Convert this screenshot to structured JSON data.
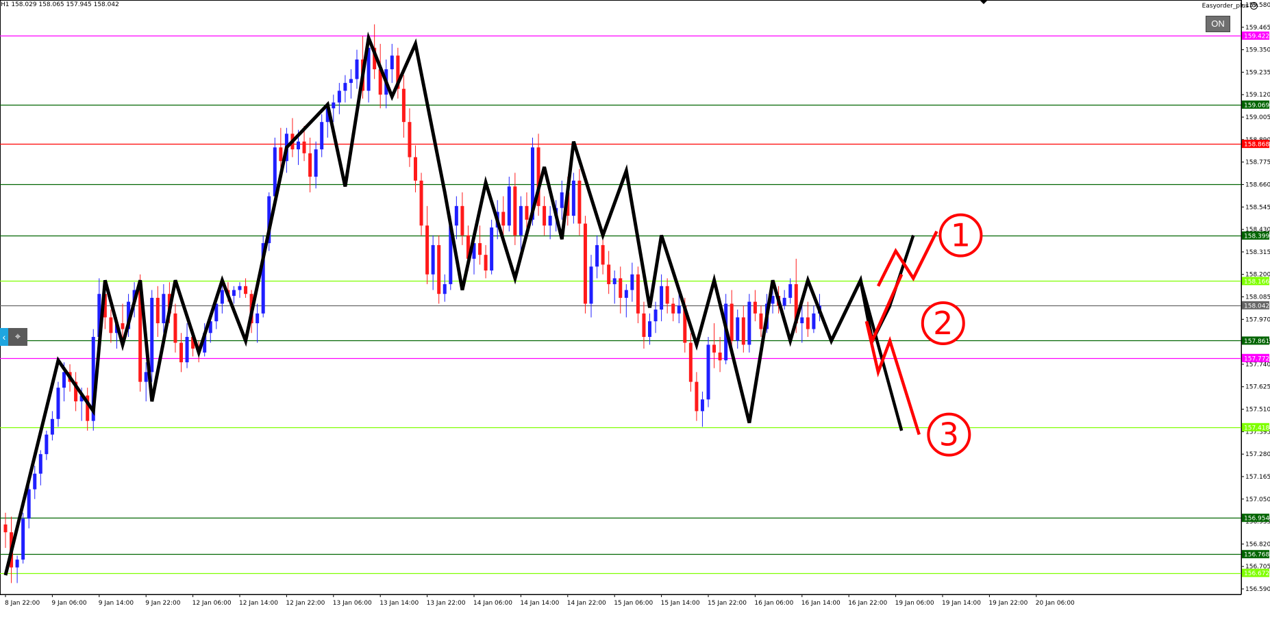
{
  "header": {
    "ohlc_text": "H1  158.029 158.065 157.945 158.042",
    "indicator_name": "Easyorder_plus",
    "indicator_icon": "smiley-icon",
    "on_button": "ON"
  },
  "tools": {
    "left_tool_icon": "arrow-left-icon",
    "cursor_tool_icon": "cursor-icon"
  },
  "chart_data": {
    "type": "candlestick",
    "symbol_timeframe": "H1",
    "ylim": [
      156.59,
      159.58
    ],
    "y_ticks": [
      "159.580",
      "159.465",
      "159.350",
      "159.235",
      "159.120",
      "159.005",
      "158.890",
      "158.775",
      "158.660",
      "158.545",
      "158.430",
      "158.315",
      "158.200",
      "158.085",
      "157.970",
      "157.855",
      "157.740",
      "157.625",
      "157.510",
      "157.395",
      "157.280",
      "157.165",
      "157.050",
      "156.935",
      "156.820",
      "156.705",
      "156.590"
    ],
    "x_ticks": [
      {
        "label": "8 Jan 22:00",
        "i": 0
      },
      {
        "label": "9 Jan 06:00",
        "i": 8
      },
      {
        "label": "9 Jan 14:00",
        "i": 16
      },
      {
        "label": "9 Jan 22:00",
        "i": 24
      },
      {
        "label": "12 Jan 06:00",
        "i": 32
      },
      {
        "label": "12 Jan 14:00",
        "i": 40
      },
      {
        "label": "12 Jan 22:00",
        "i": 48
      },
      {
        "label": "13 Jan 06:00",
        "i": 56
      },
      {
        "label": "13 Jan 14:00",
        "i": 64
      },
      {
        "label": "13 Jan 22:00",
        "i": 72
      },
      {
        "label": "14 Jan 06:00",
        "i": 80
      },
      {
        "label": "14 Jan 14:00",
        "i": 88
      },
      {
        "label": "14 Jan 22:00",
        "i": 96
      },
      {
        "label": "15 Jan 06:00",
        "i": 104
      },
      {
        "label": "15 Jan 14:00",
        "i": 112
      },
      {
        "label": "15 Jan 22:00",
        "i": 120
      },
      {
        "label": "16 Jan 06:00",
        "i": 128
      },
      {
        "label": "16 Jan 14:00",
        "i": 136
      },
      {
        "label": "16 Jan 22:00",
        "i": 144
      },
      {
        "label": "19 Jan 06:00",
        "i": 152
      },
      {
        "label": "19 Jan 14:00",
        "i": 160
      },
      {
        "label": "19 Jan 22:00",
        "i": 168
      },
      {
        "label": "20 Jan 06:00",
        "i": 176
      }
    ],
    "candle_colors": {
      "up": "#1f1fff",
      "down": "#ff1a1a"
    },
    "candles": [
      [
        156.92,
        156.98,
        156.8,
        156.88
      ],
      [
        156.88,
        156.96,
        156.62,
        156.7
      ],
      [
        156.7,
        156.76,
        156.62,
        156.74
      ],
      [
        156.74,
        156.98,
        156.72,
        156.95
      ],
      [
        156.95,
        157.15,
        156.9,
        157.1
      ],
      [
        157.1,
        157.22,
        157.05,
        157.18
      ],
      [
        157.18,
        157.3,
        157.12,
        157.28
      ],
      [
        157.28,
        157.4,
        157.25,
        157.38
      ],
      [
        157.38,
        157.5,
        157.35,
        157.46
      ],
      [
        157.46,
        157.65,
        157.42,
        157.62
      ],
      [
        157.62,
        157.75,
        157.55,
        157.7
      ],
      [
        157.7,
        157.74,
        157.6,
        157.65
      ],
      [
        157.65,
        157.7,
        157.5,
        157.55
      ],
      [
        157.55,
        157.62,
        157.45,
        157.58
      ],
      [
        157.58,
        157.62,
        157.4,
        157.45
      ],
      [
        157.45,
        157.92,
        157.4,
        157.88
      ],
      [
        157.88,
        158.18,
        157.8,
        158.1
      ],
      [
        158.1,
        158.15,
        157.92,
        157.98
      ],
      [
        157.98,
        158.02,
        157.85,
        157.9
      ],
      [
        157.9,
        157.98,
        157.82,
        157.95
      ],
      [
        157.95,
        158.05,
        157.86,
        157.92
      ],
      [
        157.92,
        158.1,
        157.88,
        158.06
      ],
      [
        158.06,
        158.16,
        157.98,
        158.12
      ],
      [
        158.12,
        158.2,
        157.6,
        157.65
      ],
      [
        157.65,
        157.75,
        157.55,
        157.7
      ],
      [
        157.7,
        158.12,
        157.65,
        158.08
      ],
      [
        158.08,
        158.14,
        157.88,
        157.95
      ],
      [
        157.95,
        158.15,
        157.9,
        158.1
      ],
      [
        158.1,
        158.16,
        157.95,
        158.0
      ],
      [
        158.0,
        158.05,
        157.8,
        157.85
      ],
      [
        157.85,
        157.9,
        157.7,
        157.75
      ],
      [
        157.75,
        157.95,
        157.72,
        157.88
      ],
      [
        157.88,
        157.92,
        157.78,
        157.82
      ],
      [
        157.82,
        157.86,
        157.75,
        157.8
      ],
      [
        157.8,
        157.95,
        157.78,
        157.9
      ],
      [
        157.9,
        158.0,
        157.85,
        157.96
      ],
      [
        157.96,
        158.1,
        157.92,
        158.05
      ],
      [
        158.05,
        158.15,
        158.0,
        158.12
      ],
      [
        158.12,
        158.16,
        158.06,
        158.09
      ],
      [
        158.09,
        158.14,
        158.05,
        158.12
      ],
      [
        158.12,
        158.16,
        158.08,
        158.14
      ],
      [
        158.14,
        158.18,
        158.08,
        158.1
      ],
      [
        158.1,
        158.12,
        157.9,
        157.95
      ],
      [
        157.95,
        158.05,
        157.85,
        158.0
      ],
      [
        158.0,
        158.4,
        157.98,
        158.36
      ],
      [
        158.36,
        158.62,
        158.32,
        158.6
      ],
      [
        158.6,
        158.9,
        158.55,
        158.85
      ],
      [
        158.85,
        158.95,
        158.7,
        158.78
      ],
      [
        158.78,
        158.95,
        158.72,
        158.92
      ],
      [
        158.92,
        159.0,
        158.8,
        158.84
      ],
      [
        158.84,
        158.94,
        158.76,
        158.88
      ],
      [
        158.88,
        158.96,
        158.78,
        158.82
      ],
      [
        158.82,
        158.9,
        158.62,
        158.7
      ],
      [
        158.7,
        158.88,
        158.64,
        158.84
      ],
      [
        158.84,
        159.02,
        158.8,
        158.98
      ],
      [
        158.98,
        159.08,
        158.9,
        159.05
      ],
      [
        159.05,
        159.12,
        158.98,
        159.08
      ],
      [
        159.08,
        159.18,
        159.02,
        159.14
      ],
      [
        159.14,
        159.22,
        159.08,
        159.18
      ],
      [
        159.18,
        159.25,
        159.1,
        159.2
      ],
      [
        159.2,
        159.35,
        159.15,
        159.3
      ],
      [
        159.3,
        159.42,
        159.1,
        159.14
      ],
      [
        159.14,
        159.4,
        159.08,
        159.36
      ],
      [
        159.36,
        159.48,
        159.2,
        159.25
      ],
      [
        159.25,
        159.38,
        159.05,
        159.12
      ],
      [
        159.12,
        159.3,
        159.05,
        159.25
      ],
      [
        159.25,
        159.38,
        159.18,
        159.32
      ],
      [
        159.32,
        159.36,
        159.1,
        159.15
      ],
      [
        159.15,
        159.22,
        158.9,
        158.98
      ],
      [
        158.98,
        159.05,
        158.75,
        158.8
      ],
      [
        158.8,
        158.86,
        158.62,
        158.68
      ],
      [
        158.68,
        158.72,
        158.4,
        158.45
      ],
      [
        158.45,
        158.55,
        158.15,
        158.2
      ],
      [
        158.2,
        158.4,
        158.12,
        158.35
      ],
      [
        158.35,
        158.4,
        158.05,
        158.1
      ],
      [
        158.1,
        158.2,
        158.06,
        158.15
      ],
      [
        158.15,
        158.5,
        158.12,
        158.45
      ],
      [
        158.45,
        158.6,
        158.38,
        158.55
      ],
      [
        158.55,
        158.62,
        158.35,
        158.4
      ],
      [
        158.4,
        158.45,
        158.22,
        158.28
      ],
      [
        158.28,
        158.42,
        158.2,
        158.36
      ],
      [
        158.36,
        158.45,
        158.25,
        158.3
      ],
      [
        158.3,
        158.35,
        158.18,
        158.22
      ],
      [
        158.22,
        158.48,
        158.2,
        158.44
      ],
      [
        158.44,
        158.58,
        158.38,
        158.52
      ],
      [
        158.52,
        158.6,
        158.4,
        158.45
      ],
      [
        158.45,
        158.7,
        158.42,
        158.65
      ],
      [
        158.65,
        158.72,
        158.35,
        158.4
      ],
      [
        158.4,
        158.6,
        158.3,
        158.55
      ],
      [
        158.55,
        158.62,
        158.42,
        158.48
      ],
      [
        158.48,
        158.9,
        158.45,
        158.85
      ],
      [
        158.85,
        158.92,
        158.5,
        158.55
      ],
      [
        158.55,
        158.6,
        158.4,
        158.45
      ],
      [
        158.45,
        158.55,
        158.38,
        158.5
      ],
      [
        158.5,
        158.58,
        158.42,
        158.54
      ],
      [
        158.54,
        158.68,
        158.48,
        158.62
      ],
      [
        158.62,
        158.7,
        158.45,
        158.5
      ],
      [
        158.5,
        158.72,
        158.46,
        158.68
      ],
      [
        158.68,
        158.74,
        158.4,
        158.46
      ],
      [
        158.46,
        158.5,
        158.0,
        158.05
      ],
      [
        158.05,
        158.3,
        157.98,
        158.24
      ],
      [
        158.24,
        158.4,
        158.18,
        158.35
      ],
      [
        158.35,
        158.42,
        158.2,
        158.25
      ],
      [
        158.25,
        158.32,
        158.1,
        158.15
      ],
      [
        158.15,
        158.22,
        158.05,
        158.18
      ],
      [
        158.18,
        158.24,
        158.0,
        158.08
      ],
      [
        158.08,
        158.15,
        157.98,
        158.12
      ],
      [
        158.12,
        158.26,
        158.06,
        158.2
      ],
      [
        158.2,
        158.24,
        157.95,
        158.0
      ],
      [
        158.0,
        158.06,
        157.82,
        157.88
      ],
      [
        157.88,
        158.0,
        157.84,
        157.96
      ],
      [
        157.96,
        158.06,
        157.9,
        158.02
      ],
      [
        158.02,
        158.2,
        157.96,
        158.14
      ],
      [
        158.14,
        158.18,
        158.0,
        158.05
      ],
      [
        158.05,
        158.08,
        157.96,
        158.0
      ],
      [
        158.0,
        158.1,
        157.95,
        158.04
      ],
      [
        158.04,
        158.08,
        157.8,
        157.85
      ],
      [
        157.85,
        157.9,
        157.6,
        157.65
      ],
      [
        157.65,
        157.7,
        157.45,
        157.5
      ],
      [
        157.5,
        157.6,
        157.42,
        157.56
      ],
      [
        157.56,
        157.88,
        157.52,
        157.84
      ],
      [
        157.84,
        157.95,
        157.72,
        157.8
      ],
      [
        157.8,
        157.88,
        157.7,
        157.76
      ],
      [
        157.76,
        158.1,
        157.74,
        158.05
      ],
      [
        158.05,
        158.12,
        157.82,
        157.86
      ],
      [
        157.86,
        158.02,
        157.82,
        157.98
      ],
      [
        157.98,
        158.04,
        157.8,
        157.84
      ],
      [
        157.84,
        158.1,
        157.8,
        158.06
      ],
      [
        158.06,
        158.12,
        157.96,
        158.0
      ],
      [
        158.0,
        158.04,
        157.88,
        157.92
      ],
      [
        157.92,
        158.1,
        157.9,
        158.05
      ],
      [
        158.05,
        158.12,
        158.0,
        158.09
      ],
      [
        158.09,
        158.14,
        158.0,
        158.04
      ],
      [
        158.04,
        158.12,
        158.02,
        158.08
      ],
      [
        158.08,
        158.18,
        158.05,
        158.15
      ],
      [
        158.15,
        158.28,
        157.9,
        157.95
      ],
      [
        157.95,
        158.05,
        157.85,
        157.98
      ],
      [
        157.98,
        158.06,
        157.88,
        157.92
      ],
      [
        157.92,
        158.04,
        157.9,
        158.0
      ],
      [
        158.0,
        158.1,
        157.96,
        158.04
      ]
    ],
    "zigzag_points": [
      [
        0,
        156.66
      ],
      [
        9,
        157.76
      ],
      [
        15,
        157.5
      ],
      [
        17,
        158.17
      ],
      [
        20,
        157.84
      ],
      [
        23,
        158.17
      ],
      [
        25,
        157.55
      ],
      [
        29,
        158.17
      ],
      [
        33,
        157.8
      ],
      [
        37,
        158.17
      ],
      [
        41,
        157.86
      ],
      [
        48,
        158.85
      ],
      [
        55,
        159.07
      ],
      [
        58,
        158.65
      ],
      [
        62,
        159.41
      ],
      [
        66,
        159.11
      ],
      [
        70,
        159.38
      ],
      [
        75,
        158.62
      ],
      [
        78,
        158.12
      ],
      [
        82,
        158.67
      ],
      [
        87,
        158.18
      ],
      [
        92,
        158.75
      ],
      [
        95,
        158.38
      ],
      [
        97,
        158.88
      ],
      [
        102,
        158.4
      ],
      [
        106,
        158.73
      ],
      [
        110,
        158.03
      ],
      [
        112,
        158.4
      ],
      [
        118,
        157.84
      ],
      [
        121,
        158.17
      ],
      [
        127,
        157.44
      ],
      [
        131,
        158.17
      ],
      [
        134,
        157.86
      ],
      [
        137,
        158.17
      ],
      [
        141,
        157.86
      ],
      [
        146,
        158.17
      ],
      [
        148,
        157.86
      ],
      [
        151,
        158.04
      ]
    ],
    "projection_paths": {
      "black_up": [
        [
          148,
          157.86
        ],
        [
          151,
          158.04
        ],
        [
          155,
          158.4
        ]
      ],
      "black_down": [
        [
          146,
          158.17
        ],
        [
          153,
          157.4
        ]
      ],
      "red_1": [
        [
          149,
          158.14
        ],
        [
          152,
          158.32
        ],
        [
          155,
          158.18
        ],
        [
          159,
          158.42
        ]
      ],
      "red_2": [
        [
          147,
          157.96
        ],
        [
          148,
          157.86
        ],
        [
          153,
          158.2
        ]
      ],
      "red_3": [
        [
          147,
          157.96
        ],
        [
          149,
          157.7
        ],
        [
          151,
          157.86
        ],
        [
          156,
          157.38
        ]
      ]
    },
    "scenario_markers": [
      {
        "label": "1",
        "at": [
          159,
          158.4
        ]
      },
      {
        "label": "2",
        "at": [
          156,
          157.95
        ]
      },
      {
        "label": "3",
        "at": [
          157,
          157.38
        ]
      }
    ],
    "levels": [
      {
        "price": 159.422,
        "color": "#ff00ff",
        "label": "159.422",
        "label_text_color": "#ffffff"
      },
      {
        "price": 159.069,
        "color": "#006400",
        "label": "159.069",
        "label_text_color": "#ffffff"
      },
      {
        "price": 158.868,
        "color": "#ff0000",
        "label": "158.868",
        "label_text_color": "#ffffff"
      },
      {
        "price": 158.66,
        "color": "#006400",
        "label": "",
        "label_text_color": "#ffffff"
      },
      {
        "price": 158.399,
        "color": "#006400",
        "label": "158.399",
        "label_text_color": "#ffffff"
      },
      {
        "price": 158.166,
        "color": "#7fff00",
        "label": "158.166",
        "label_text_color": "#ffffff"
      },
      {
        "price": 158.042,
        "color": "#666666",
        "label": "158.042",
        "label_text_color": "#ffffff"
      },
      {
        "price": 157.861,
        "color": "#006400",
        "label": "157.861",
        "label_text_color": "#ffffff"
      },
      {
        "price": 157.772,
        "color": "#ff00ff",
        "label": "157.772",
        "label_text_color": "#ffffff"
      },
      {
        "price": 157.418,
        "color": "#7fff00",
        "label": "157.418",
        "label_text_color": "#ffffff"
      },
      {
        "price": 156.954,
        "color": "#006400",
        "label": "156.954",
        "label_text_color": "#ffffff"
      },
      {
        "price": 156.768,
        "color": "#006400",
        "label": "156.768",
        "label_text_color": "#ffffff"
      },
      {
        "price": 156.672,
        "color": "#7fff00",
        "label": "156.672",
        "label_text_color": "#ffffff"
      }
    ]
  }
}
